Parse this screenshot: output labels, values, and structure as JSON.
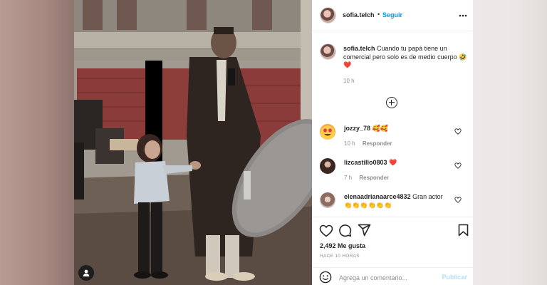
{
  "post": {
    "username": "sofia.telch",
    "follow_label": "Seguir",
    "caption_text": "Cuando tu papá tiene un comercial pero solo es de medio cuerpo 🤣❤️",
    "caption_time": "10 h",
    "likes": "2,492 Me gusta",
    "posted_ago": "HACE 10 HORAS"
  },
  "comments": [
    {
      "username": "jozzy_78",
      "text": "🥰🥰",
      "time": "10 h",
      "reply": "Responder"
    },
    {
      "username": "lizcastillo0803",
      "text": "❤️",
      "time": "7 h",
      "reply": "Responder"
    },
    {
      "username": "elenaadrianaarce4832",
      "text": "Gran actor",
      "emojis": "👏👏👏👏👏👏"
    }
  ],
  "comment_box": {
    "placeholder": "Agrega un comentario...",
    "publish_label": "Publicar"
  },
  "icons": [
    "more-options-icon",
    "add-comment-icon",
    "like-icon",
    "comment-icon",
    "share-icon",
    "save-icon",
    "heart-small-icon",
    "emoji-icon",
    "tagged-user-icon"
  ],
  "colors": {
    "follow_blue": "#0095f6",
    "publish_disabled": "#b2dffc",
    "text": "#262626",
    "muted": "#8e8e8e",
    "heart": "#ed4956"
  }
}
